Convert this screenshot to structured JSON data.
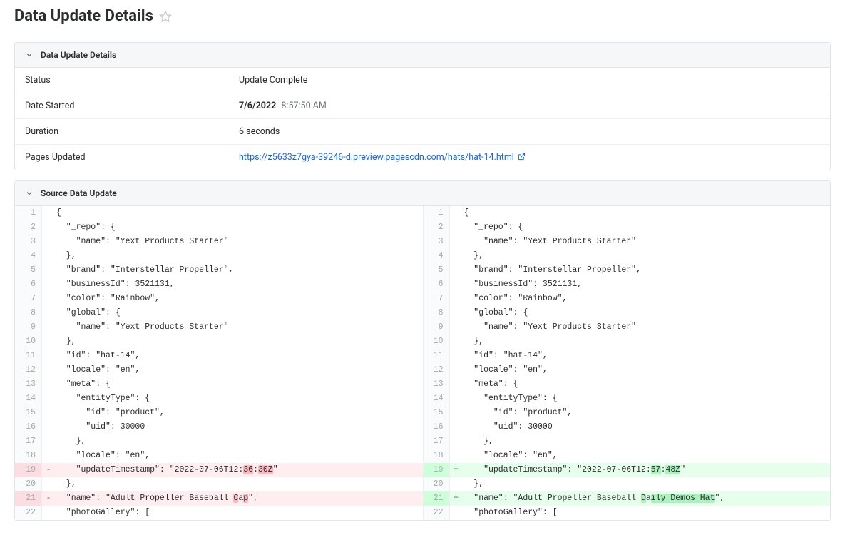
{
  "pageTitle": "Data Update Details",
  "panels": {
    "details": {
      "title": "Data Update Details",
      "rows": {
        "status": {
          "label": "Status",
          "value": "Update Complete"
        },
        "dateStarted": {
          "label": "Date Started",
          "date": "7/6/2022",
          "time": "8:57:50 AM"
        },
        "duration": {
          "label": "Duration",
          "value": "6 seconds"
        },
        "pagesUpdated": {
          "label": "Pages Updated",
          "url": "https://z5633z7gya-39246-d.preview.pagescdn.com/hats/hat-14.html"
        }
      }
    },
    "source": {
      "title": "Source Data Update"
    }
  },
  "diff": {
    "left": [
      {
        "n": 1,
        "type": "ctx",
        "segs": [
          {
            "t": "{"
          }
        ]
      },
      {
        "n": 2,
        "type": "ctx",
        "segs": [
          {
            "t": "  \"_repo\": {"
          }
        ]
      },
      {
        "n": 3,
        "type": "ctx",
        "segs": [
          {
            "t": "    \"name\": \"Yext Products Starter\""
          }
        ]
      },
      {
        "n": 4,
        "type": "ctx",
        "segs": [
          {
            "t": "  },"
          }
        ]
      },
      {
        "n": 5,
        "type": "ctx",
        "segs": [
          {
            "t": "  \"brand\": \"Interstellar Propeller\","
          }
        ]
      },
      {
        "n": 6,
        "type": "ctx",
        "segs": [
          {
            "t": "  \"businessId\": 3521131,"
          }
        ]
      },
      {
        "n": 7,
        "type": "ctx",
        "segs": [
          {
            "t": "  \"color\": \"Rainbow\","
          }
        ]
      },
      {
        "n": 8,
        "type": "ctx",
        "segs": [
          {
            "t": "  \"global\": {"
          }
        ]
      },
      {
        "n": 9,
        "type": "ctx",
        "segs": [
          {
            "t": "    \"name\": \"Yext Products Starter\""
          }
        ]
      },
      {
        "n": 10,
        "type": "ctx",
        "segs": [
          {
            "t": "  },"
          }
        ]
      },
      {
        "n": 11,
        "type": "ctx",
        "segs": [
          {
            "t": "  \"id\": \"hat-14\","
          }
        ]
      },
      {
        "n": 12,
        "type": "ctx",
        "segs": [
          {
            "t": "  \"locale\": \"en\","
          }
        ]
      },
      {
        "n": 13,
        "type": "ctx",
        "segs": [
          {
            "t": "  \"meta\": {"
          }
        ]
      },
      {
        "n": 14,
        "type": "ctx",
        "segs": [
          {
            "t": "    \"entityType\": {"
          }
        ]
      },
      {
        "n": 15,
        "type": "ctx",
        "segs": [
          {
            "t": "      \"id\": \"product\","
          }
        ]
      },
      {
        "n": 16,
        "type": "ctx",
        "segs": [
          {
            "t": "      \"uid\": 30000"
          }
        ]
      },
      {
        "n": 17,
        "type": "ctx",
        "segs": [
          {
            "t": "    },"
          }
        ]
      },
      {
        "n": 18,
        "type": "ctx",
        "segs": [
          {
            "t": "    \"locale\": \"en\","
          }
        ]
      },
      {
        "n": 19,
        "type": "del",
        "segs": [
          {
            "t": "    \"updateTimestamp\": \"2022-07-06T12:"
          },
          {
            "t": "36",
            "hl": true
          },
          {
            "t": ":"
          },
          {
            "t": "30",
            "hl": true
          },
          {
            "t": "Z",
            "hl": true
          },
          {
            "t": "\""
          }
        ]
      },
      {
        "n": 20,
        "type": "ctx",
        "segs": [
          {
            "t": "  },"
          }
        ]
      },
      {
        "n": 21,
        "type": "del",
        "segs": [
          {
            "t": "  \"name\": \"Adult Propeller Baseball "
          },
          {
            "t": "C",
            "hl": true
          },
          {
            "t": "a"
          },
          {
            "t": "p",
            "hl": true
          },
          {
            "t": "\","
          }
        ]
      },
      {
        "n": 22,
        "type": "ctx",
        "segs": [
          {
            "t": "  \"photoGallery\": ["
          }
        ]
      }
    ],
    "right": [
      {
        "n": 1,
        "type": "ctx",
        "segs": [
          {
            "t": "{"
          }
        ]
      },
      {
        "n": 2,
        "type": "ctx",
        "segs": [
          {
            "t": "  \"_repo\": {"
          }
        ]
      },
      {
        "n": 3,
        "type": "ctx",
        "segs": [
          {
            "t": "    \"name\": \"Yext Products Starter\""
          }
        ]
      },
      {
        "n": 4,
        "type": "ctx",
        "segs": [
          {
            "t": "  },"
          }
        ]
      },
      {
        "n": 5,
        "type": "ctx",
        "segs": [
          {
            "t": "  \"brand\": \"Interstellar Propeller\","
          }
        ]
      },
      {
        "n": 6,
        "type": "ctx",
        "segs": [
          {
            "t": "  \"businessId\": 3521131,"
          }
        ]
      },
      {
        "n": 7,
        "type": "ctx",
        "segs": [
          {
            "t": "  \"color\": \"Rainbow\","
          }
        ]
      },
      {
        "n": 8,
        "type": "ctx",
        "segs": [
          {
            "t": "  \"global\": {"
          }
        ]
      },
      {
        "n": 9,
        "type": "ctx",
        "segs": [
          {
            "t": "    \"name\": \"Yext Products Starter\""
          }
        ]
      },
      {
        "n": 10,
        "type": "ctx",
        "segs": [
          {
            "t": "  },"
          }
        ]
      },
      {
        "n": 11,
        "type": "ctx",
        "segs": [
          {
            "t": "  \"id\": \"hat-14\","
          }
        ]
      },
      {
        "n": 12,
        "type": "ctx",
        "segs": [
          {
            "t": "  \"locale\": \"en\","
          }
        ]
      },
      {
        "n": 13,
        "type": "ctx",
        "segs": [
          {
            "t": "  \"meta\": {"
          }
        ]
      },
      {
        "n": 14,
        "type": "ctx",
        "segs": [
          {
            "t": "    \"entityType\": {"
          }
        ]
      },
      {
        "n": 15,
        "type": "ctx",
        "segs": [
          {
            "t": "      \"id\": \"product\","
          }
        ]
      },
      {
        "n": 16,
        "type": "ctx",
        "segs": [
          {
            "t": "      \"uid\": 30000"
          }
        ]
      },
      {
        "n": 17,
        "type": "ctx",
        "segs": [
          {
            "t": "    },"
          }
        ]
      },
      {
        "n": 18,
        "type": "ctx",
        "segs": [
          {
            "t": "    \"locale\": \"en\","
          }
        ]
      },
      {
        "n": 19,
        "type": "add",
        "segs": [
          {
            "t": "    \"updateTimestamp\": \"2022-07-06T12:"
          },
          {
            "t": "57",
            "hl": true
          },
          {
            "t": ":"
          },
          {
            "t": "48",
            "hl": true
          },
          {
            "t": "Z",
            "hl": true
          },
          {
            "t": "\""
          }
        ]
      },
      {
        "n": 20,
        "type": "ctx",
        "segs": [
          {
            "t": "  },"
          }
        ]
      },
      {
        "n": 21,
        "type": "add",
        "segs": [
          {
            "t": "  \"name\": \"Adult Propeller Baseball "
          },
          {
            "t": "D",
            "hl": true
          },
          {
            "t": "a"
          },
          {
            "t": "ily Demos Hat",
            "hl": true
          },
          {
            "t": "\","
          }
        ]
      },
      {
        "n": 22,
        "type": "ctx",
        "segs": [
          {
            "t": "  \"photoGallery\": ["
          }
        ]
      }
    ]
  }
}
